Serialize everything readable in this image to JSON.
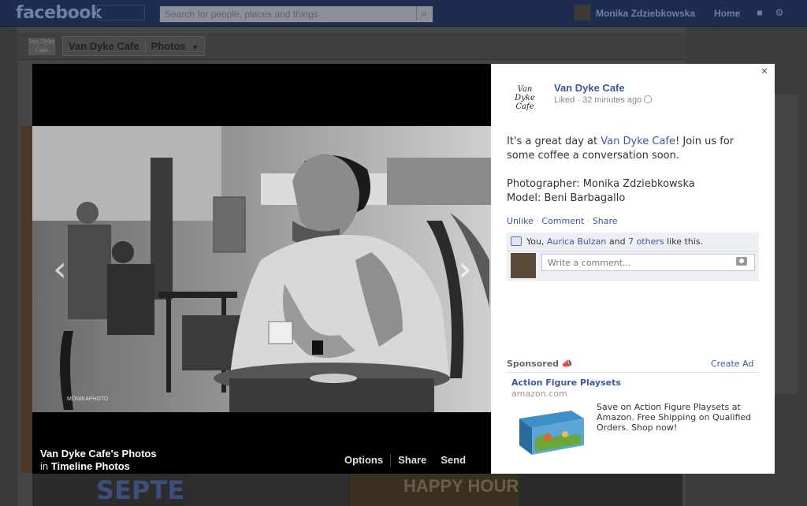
{
  "topbar": {
    "logo": "facebook",
    "search_placeholder": "Search for people, places and things",
    "user_name": "Monika Zdziebkowska",
    "home_label": "Home"
  },
  "subbar": {
    "page_logo_text": "Van Dyke Cafe",
    "crumb_page": "Van Dyke Cafe",
    "crumb_section": "Photos",
    "dropdown_icon": "caret-down"
  },
  "background": {
    "septe": "SEPTE",
    "happy_hour": "HAPPY HOUR"
  },
  "photo": {
    "watermark": "MONIKAPHOTO",
    "album_title": "Van Dyke Cafe's Photos",
    "in_label": "in",
    "album_name": "Timeline Photos",
    "actions": [
      "Options",
      "Share",
      "Send"
    ]
  },
  "post": {
    "page_logo_text": "Van Dyke Cafe",
    "page_name": "Van Dyke Cafe",
    "meta": "Liked · 32 minutes ago",
    "text_before": "It's a great day at ",
    "text_link": "Van Dyke Cafe",
    "text_after": "! Join us for some coffee a conversation soon.",
    "photographer": "Photographer: Monika Zdziebkowska",
    "model": "Model: Beni Barbagallo",
    "action_unlike": "Unlike",
    "action_comment": "Comment",
    "action_share": "Share",
    "likes_prefix": "You, ",
    "likes_name": "Aurica Bulzan",
    "likes_and": " and ",
    "likes_others": "7 others",
    "likes_suffix": " like this.",
    "comment_placeholder": "Write a comment..."
  },
  "ad": {
    "sponsored_label": "Sponsored",
    "create_ad": "Create Ad",
    "title": "Action Figure Playsets",
    "domain": "amazon.com",
    "body": "Save on Action Figure Playsets at Amazon. Free Shipping on Qualified Orders. Shop now!"
  },
  "colors": {
    "link": "#3b5998",
    "topbar": "#1e2d4f",
    "likes_bg": "#edeff4"
  }
}
